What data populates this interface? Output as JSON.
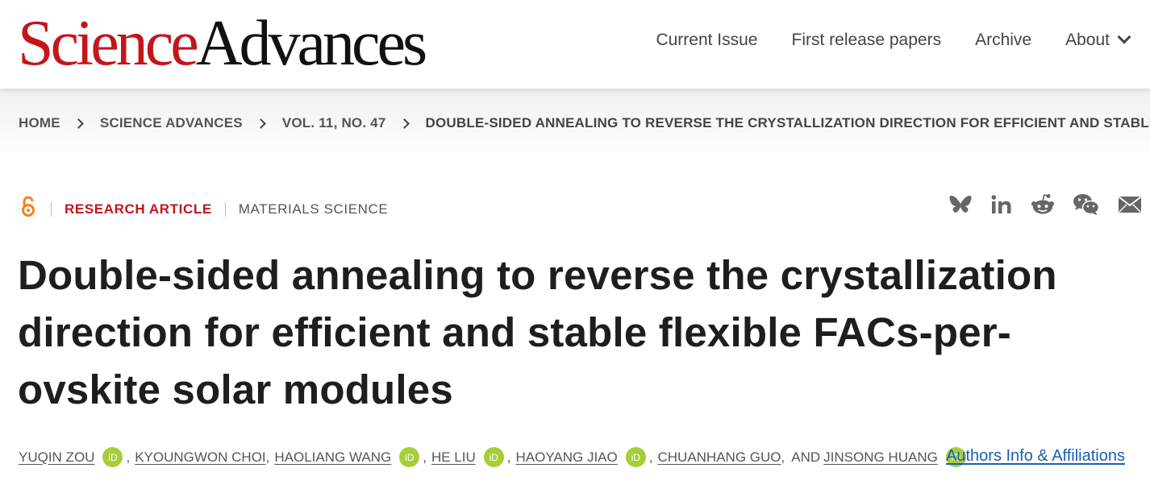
{
  "header": {
    "logo_primary": "Science",
    "logo_secondary": "Advances",
    "nav": [
      {
        "label": "Current Issue"
      },
      {
        "label": "First release papers"
      },
      {
        "label": "Archive"
      },
      {
        "label": "About"
      }
    ]
  },
  "breadcrumb": [
    "HOME",
    "SCIENCE ADVANCES",
    "VOL. 11, NO. 47",
    "DOUBLE-SIDED ANNEALING TO REVERSE THE CRYSTALLIZATION DIRECTION FOR EFFICIENT AND STABLE…"
  ],
  "article": {
    "type": "RESEARCH ARTICLE",
    "subject": "MATERIALS SCIENCE",
    "title_lines": [
      "Double-sided annealing to reverse the crystallization",
      "direction for efficient and stable flexible FACs-per-",
      "ovskite solar modules"
    ],
    "authors": [
      {
        "name": "YUQIN ZOU",
        "orcid": true
      },
      {
        "name": "KYOUNGWON CHOI",
        "orcid": false
      },
      {
        "name": "HAOLIANG WANG",
        "orcid": true
      },
      {
        "name": "HE LIU",
        "orcid": true
      },
      {
        "name": "HAOYANG JIAO",
        "orcid": true
      },
      {
        "name": "CHUANHANG GUO",
        "orcid": false
      },
      {
        "name": "JINSONG HUANG",
        "orcid": true
      }
    ],
    "and_text": "AND",
    "affiliations_link": "Authors Info & Affiliations",
    "orcid_label": "iD"
  },
  "share_icons": [
    "bluesky-icon",
    "linkedin-icon",
    "reddit-icon",
    "wechat-icon",
    "email-icon"
  ],
  "colors": {
    "brand_red": "#c3161c",
    "link_blue": "#1a5eb3",
    "orcid_green": "#a6ce39",
    "open_access_orange": "#f58220"
  }
}
